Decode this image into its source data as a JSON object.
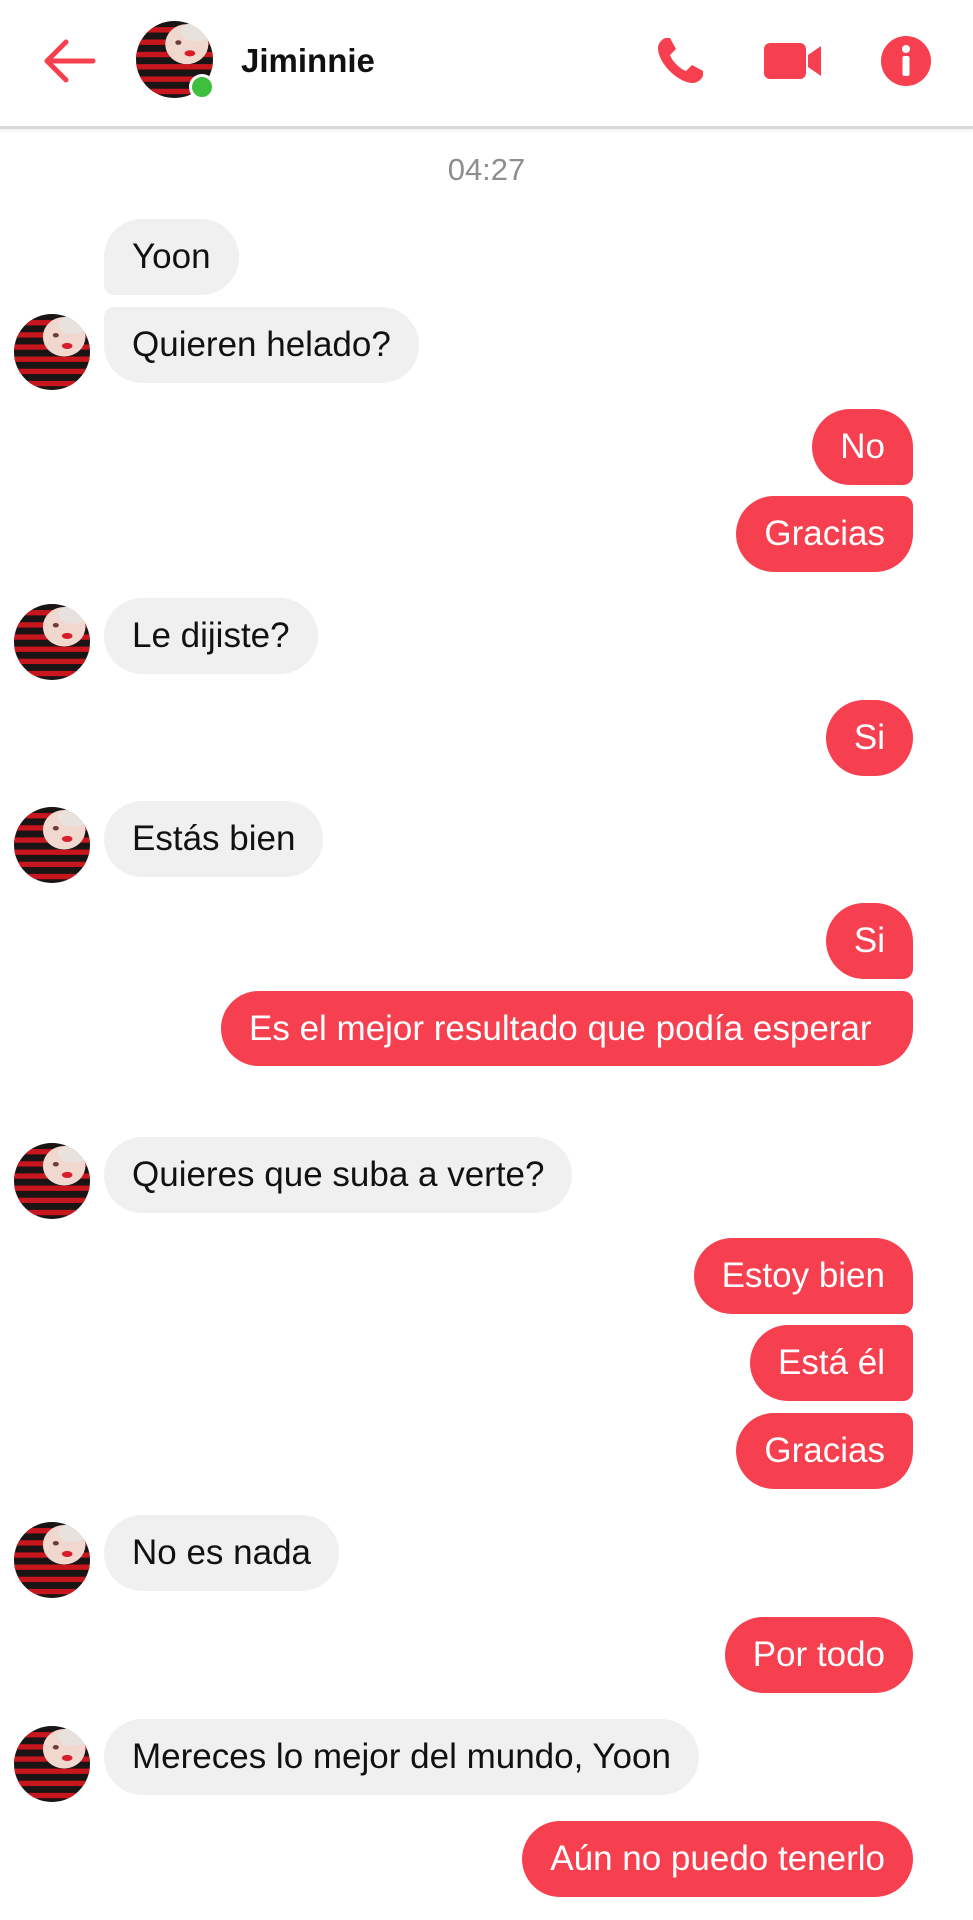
{
  "header": {
    "contact_name": "Jiminnie",
    "online": true,
    "icons": [
      "back-arrow-icon",
      "phone-icon",
      "video-camera-icon",
      "info-icon"
    ]
  },
  "colors": {
    "accent": "#f7404f",
    "incoming_bubble": "#f0f0f0",
    "online": "#3fbf3f"
  },
  "conversation": {
    "timestamp": "04:27",
    "messages": [
      {
        "from": "them",
        "text": "Yoon"
      },
      {
        "from": "them",
        "text": "Quieren helado?"
      },
      {
        "from": "me",
        "text": "No"
      },
      {
        "from": "me",
        "text": "Gracias"
      },
      {
        "from": "them",
        "text": "Le dijiste?"
      },
      {
        "from": "me",
        "text": "Si"
      },
      {
        "from": "them",
        "text": "Estás bien"
      },
      {
        "from": "me",
        "text": "Si"
      },
      {
        "from": "me",
        "text": "Es el mejor resultado que podía esperar"
      },
      {
        "from": "them",
        "text": "Quieres que suba a verte?"
      },
      {
        "from": "me",
        "text": "Estoy bien"
      },
      {
        "from": "me",
        "text": "Está él"
      },
      {
        "from": "me",
        "text": "Gracias"
      },
      {
        "from": "them",
        "text": "No es nada"
      },
      {
        "from": "me",
        "text": "Por todo"
      },
      {
        "from": "them",
        "text": "Mereces lo mejor del mundo, Yoon"
      },
      {
        "from": "me",
        "text": "Aún no puedo tenerlo"
      }
    ]
  }
}
